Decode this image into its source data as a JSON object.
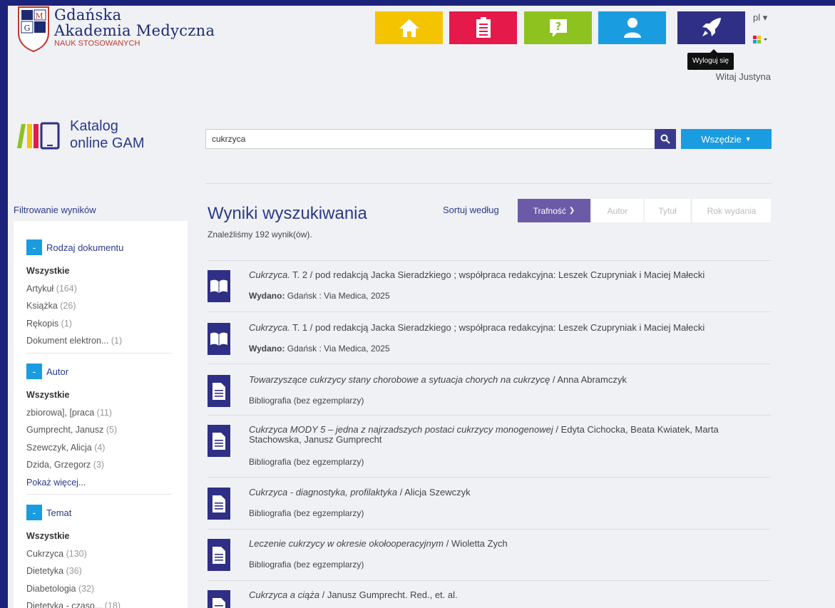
{
  "header": {
    "logo_line1": "Gdańska",
    "logo_line2": "Akademia Medyczna",
    "logo_line3": "NAUK STOSOWANYCH",
    "nav_tiles": [
      {
        "name": "home",
        "icon": "home-icon",
        "color": "#f5c400"
      },
      {
        "name": "clipboard",
        "icon": "clipboard-icon",
        "color": "#e6194b"
      },
      {
        "name": "help",
        "icon": "help-icon",
        "color": "#8dc21f"
      },
      {
        "name": "user",
        "icon": "user-icon",
        "color": "#1a9ce0"
      },
      {
        "name": "logout",
        "icon": "rocket-icon",
        "color": "#2f2f85"
      }
    ],
    "language": "pl",
    "tooltip": "Wyloguj się",
    "greeting": "Witaj Justyna"
  },
  "catalog": {
    "title_line1": "Katalog",
    "title_line2": "online GAM"
  },
  "search": {
    "value": "cukrzyca",
    "scope_label": "Wszędzie"
  },
  "sidebar": {
    "title": "Filtrowanie wyników",
    "facets": [
      {
        "label": "Rodzaj dokumentu",
        "items": [
          {
            "text": "Wszystkie",
            "count": ""
          },
          {
            "text": "Artykuł",
            "count": "(164)"
          },
          {
            "text": "Książka",
            "count": "(26)"
          },
          {
            "text": "Rękopis",
            "count": "(1)"
          },
          {
            "text": "Dokument elektron...",
            "count": "(1)"
          }
        ]
      },
      {
        "label": "Autor",
        "items": [
          {
            "text": "Wszystkie",
            "count": ""
          },
          {
            "text": "zbiorowa], [praca",
            "count": "(11)"
          },
          {
            "text": "Gumprecht, Janusz",
            "count": "(5)"
          },
          {
            "text": "Szewczyk, Alicja",
            "count": "(4)"
          },
          {
            "text": "Dzida, Grzegorz",
            "count": "(3)"
          }
        ],
        "more": "Pokaż więcej..."
      },
      {
        "label": "Temat",
        "items": [
          {
            "text": "Wszystkie",
            "count": ""
          },
          {
            "text": "Cukrzyca",
            "count": "(130)"
          },
          {
            "text": "Dietetyka",
            "count": "(36)"
          },
          {
            "text": "Diabetologia",
            "count": "(32)"
          },
          {
            "text": "Dietetyka - czaso...",
            "count": "(18)"
          }
        ]
      }
    ]
  },
  "results": {
    "title": "Wyniki wyszukiwania",
    "found": "Znaleźliśmy 192 wynik(ów).",
    "sort_label": "Sortuj według",
    "sort_options": [
      "Trafność",
      "Autor",
      "Tytuł",
      "Rok wydania"
    ],
    "items": [
      {
        "icon": "book-icon",
        "title": "Cukrzyca.",
        "rest": " T. 2 / pod redakcją Jacka Sieradzkiego ; współpraca redakcyjna: Leszek Czupryniak i Maciej Małecki",
        "meta_label": "Wydano:",
        "meta": " Gdańsk : Via Medica, 2025"
      },
      {
        "icon": "book-icon",
        "title": "Cukrzyca.",
        "rest": " T. 1 / pod redakcją Jacka Sieradzkiego ; współpraca redakcyjna: Leszek Czupryniak i Maciej Małecki",
        "meta_label": "Wydano:",
        "meta": " Gdańsk : Via Medica, 2025"
      },
      {
        "icon": "document-icon",
        "title": "Towarzyszące cukrzycy stany chorobowe a sytuacja chorych na cukrzycę",
        "rest": " / Anna Abramczyk",
        "meta_label": "",
        "meta": "Bibliografia (bez egzemplarzy)"
      },
      {
        "icon": "document-icon",
        "title": "Cukrzyca MODY 5 – jedna z najrzadszych postaci cukrzycy monogenowej",
        "rest": " / Edyta Cichocka, Beata Kwiatek, Marta Stachowska, Janusz Gumprecht",
        "meta_label": "",
        "meta": "Bibliografia (bez egzemplarzy)"
      },
      {
        "icon": "document-icon",
        "title": "Cukrzyca - diagnostyka, profilaktyka",
        "rest": " / Alicja Szewczyk",
        "meta_label": "",
        "meta": "Bibliografia (bez egzemplarzy)"
      },
      {
        "icon": "document-icon",
        "title": "Leczenie cukrzycy w okresie okołooperacyjnym",
        "rest": " / Wioletta Zych",
        "meta_label": "",
        "meta": "Bibliografia (bez egzemplarzy)"
      },
      {
        "icon": "document-icon",
        "title": "Cukrzyca a ciąża",
        "rest": " / Janusz Gumprecht. Red., et. al.",
        "meta_label": "",
        "meta": ""
      }
    ]
  }
}
